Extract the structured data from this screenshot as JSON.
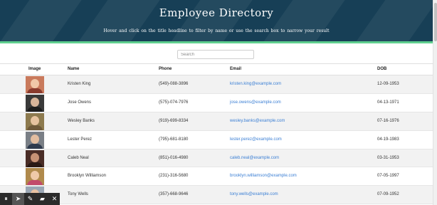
{
  "header": {
    "title": "Employee Directory",
    "subtitle": "Hover and click on the title headline to filter by name or use the search box to narrow your result"
  },
  "search": {
    "placeholder": "Search",
    "value": ""
  },
  "table": {
    "columns": [
      "Image",
      "Name",
      "Phone",
      "Email",
      "DOB"
    ],
    "rows": [
      {
        "name": "Kristen King",
        "phone": "(549)-088-3896",
        "email": "kristen.king@example.com",
        "dob": "12-09-1953"
      },
      {
        "name": "Jose Owens",
        "phone": "(575)-074-7976",
        "email": "jose.owens@example.com",
        "dob": "04-13-1971"
      },
      {
        "name": "Wesley Banks",
        "phone": "(919)-699-8334",
        "email": "wesley.banks@example.com",
        "dob": "07-16-1976"
      },
      {
        "name": "Lester Perez",
        "phone": "(795)-681-8180",
        "email": "lester.perez@example.com",
        "dob": "04-19-1983"
      },
      {
        "name": "Caleb Neal",
        "phone": "(851)-016-4980",
        "email": "caleb.neal@example.com",
        "dob": "03-31-1953"
      },
      {
        "name": "Brooklyn Williamson",
        "phone": "(231)-316-5680",
        "email": "brooklyn.williamson@example.com",
        "dob": "07-05-1997"
      },
      {
        "name": "Tony Wells",
        "phone": "(357)-668-9646",
        "email": "tony.wells@example.com",
        "dob": "07-09-1952"
      }
    ]
  },
  "colors": {
    "header_bg": "#173f56",
    "accent": "#5fcf8f",
    "link": "#3b7fd4",
    "stripe_row": "#f2f2f2"
  },
  "avatars": [
    {
      "bg": "#c97a5c",
      "skin": "#f0c7a8",
      "shirt": "#8a3b2e"
    },
    {
      "bg": "#3a3a3a",
      "skin": "#d8b59a",
      "shirt": "#1e1e1e"
    },
    {
      "bg": "#8d7a4e",
      "skin": "#e6c39f",
      "shirt": "#6f5a3a"
    },
    {
      "bg": "#7a7f86",
      "skin": "#e2bda0",
      "shirt": "#2f3b4e"
    },
    {
      "bg": "#4a2d26",
      "skin": "#c79275",
      "shirt": "#2a1a16"
    },
    {
      "bg": "#b08a4c",
      "skin": "#efc9a8",
      "shirt": "#c24a6b"
    },
    {
      "bg": "#9aa6b4",
      "skin": "#e8c2a3",
      "shirt": "#3f4f64"
    }
  ],
  "toolbar": {
    "tools": [
      {
        "icon": "pause-icon",
        "glyph": "⏸"
      },
      {
        "icon": "pointer-icon",
        "glyph": "➤"
      },
      {
        "icon": "pen-icon",
        "glyph": "✎"
      },
      {
        "icon": "eraser-icon",
        "glyph": "▰"
      },
      {
        "icon": "close-icon",
        "glyph": "✕"
      }
    ]
  }
}
